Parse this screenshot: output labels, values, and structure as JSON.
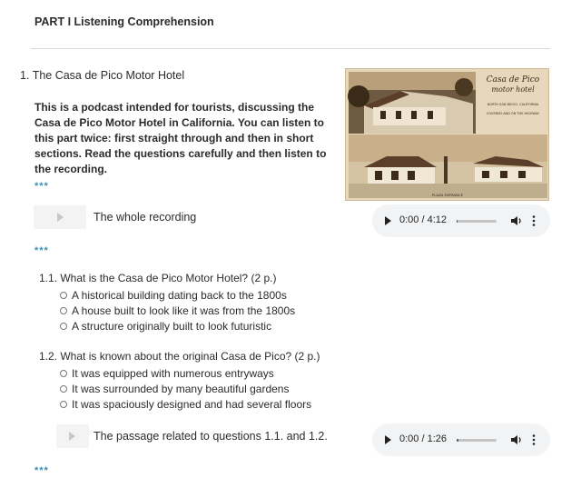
{
  "page": {
    "part_title": "PART I Listening Comprehension"
  },
  "question": {
    "number": "1.",
    "title": "The Casa de Pico Motor Hotel",
    "intro": "This is a podcast intended for tourists, discussing the Casa de Pico Motor Hotel in California. You can listen to this part twice: first straight through and then in short sections. Read the questions carefully and then listen to the recording.",
    "separator": "***"
  },
  "postcard": {
    "title_line1": "Casa de Pico",
    "title_line2": "motor hotel",
    "address": "NORTH SAN DIEGO, CALIFORNIA",
    "footer": "PLAZA ENTRANCE",
    "note": "COVERED AND ON THE HIGHWAY"
  },
  "recordings": [
    {
      "label": "The whole recording",
      "player_time": "0:00 / 4:12",
      "progress": 0.02
    },
    {
      "label": "The passage related to questions 1.1. and 1.2.",
      "player_time": "0:00 / 1:26",
      "progress": 0.05
    }
  ],
  "sub_questions": [
    {
      "text": "1.1. What is the Casa de Pico Motor Hotel? (2 p.)",
      "options": [
        "A historical building dating back to the 1800s",
        "A house built to look like it was from the 1800s",
        "A structure originally built to look futuristic"
      ]
    },
    {
      "text": "1.2. What is known about the original Casa de Pico? (2 p.)",
      "options": [
        "It was equipped with numerous entryways",
        "It was surrounded by many beautiful gardens",
        "It was spaciously designed and had several floors"
      ]
    }
  ],
  "icons": {
    "play": "play-icon",
    "volume": "volume-icon",
    "more": "more-vertical-icon"
  }
}
